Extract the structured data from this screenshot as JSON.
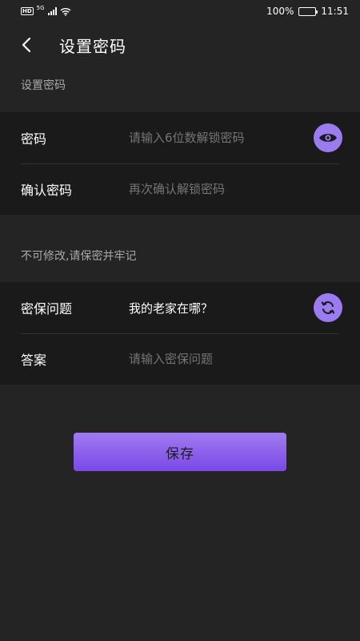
{
  "status_bar": {
    "hd": "HD",
    "network": "5G",
    "battery_percent": "100%",
    "time": "11:51"
  },
  "header": {
    "title": "设置密码",
    "back_icon": "chevron-left-icon"
  },
  "section_password": {
    "label": "设置密码",
    "rows": [
      {
        "label": "密码",
        "placeholder": "请输入6位数解锁密码",
        "icon": "eye-icon"
      },
      {
        "label": "确认密码",
        "placeholder": "再次确认解锁密码"
      }
    ]
  },
  "section_security": {
    "label": "不可修改,请保密并牢记",
    "rows": [
      {
        "label": "密保问题",
        "value": "我的老家在哪？",
        "icon": "refresh-icon"
      },
      {
        "label": "答案",
        "placeholder": "请输入密保问题"
      }
    ]
  },
  "save_button": {
    "label": "保存"
  },
  "colors": {
    "background": "#242424",
    "card": "#1a1a1a",
    "accent": "#9b7bf0",
    "button_gradient_top": "#a07bf0",
    "button_gradient_bottom": "#7a49e6"
  }
}
